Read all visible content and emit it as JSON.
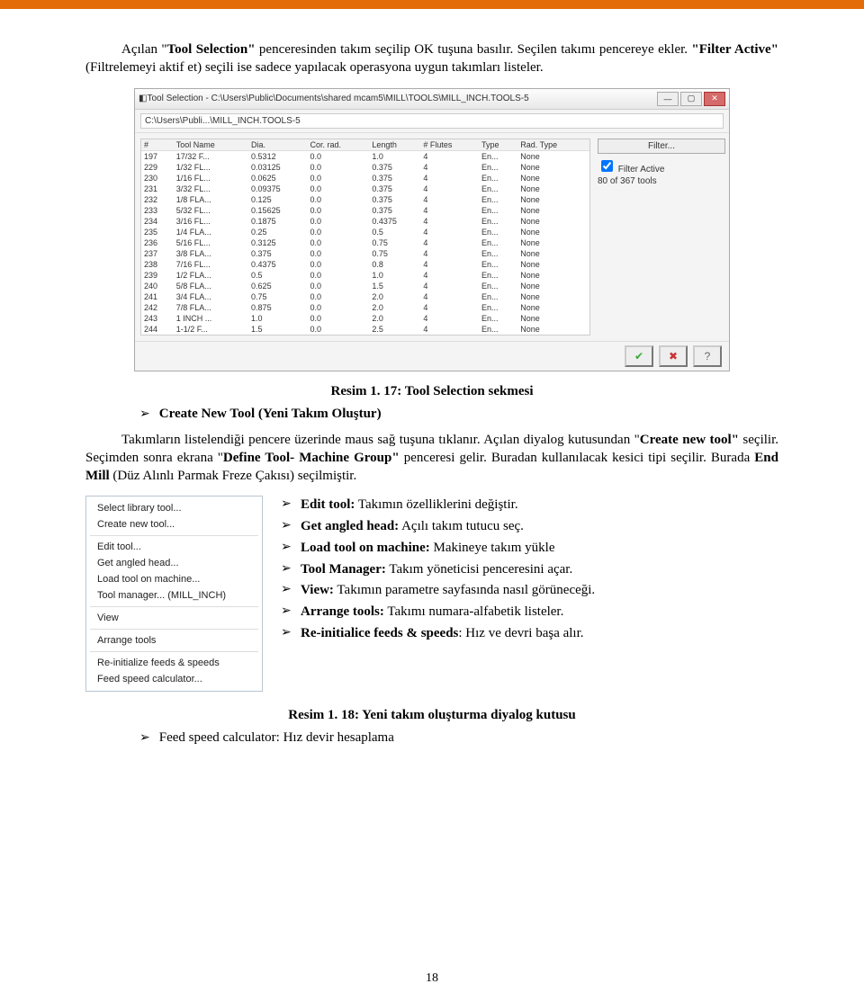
{
  "intro": {
    "sentence1_prefix": "Açılan \"",
    "sentence1_bold": "Tool Selection\"",
    "sentence1_suffix": " penceresinden takım seçilip OK tuşuna basılır. Seçilen takımı pencereye ekler. ",
    "sentence2_bold": "\"Filter Active\"",
    "sentence2_suffix": " (Filtrelemeyi aktif et) seçili ise sadece yapılacak operasyona uygun takımları listeler."
  },
  "win": {
    "title": "Tool Selection - C:\\Users\\Public\\Documents\\shared mcam5\\MILL\\TOOLS\\MILL_INCH.TOOLS-5",
    "path": "C:\\Users\\Publi...\\MILL_INCH.TOOLS-5",
    "winbtn_min": "—",
    "winbtn_max": "▢",
    "winbtn_close": "✕",
    "headers": [
      "#",
      "Tool Name",
      "Dia.",
      "Cor. rad.",
      "Length",
      "# Flutes",
      "Type",
      "Rad. Type"
    ],
    "rows": [
      [
        "197",
        "17/32 F...",
        "0.5312",
        "0.0",
        "1.0",
        "4",
        "En...",
        "None"
      ],
      [
        "229",
        "1/32 FL...",
        "0.03125",
        "0.0",
        "0.375",
        "4",
        "En...",
        "None"
      ],
      [
        "230",
        "1/16 FL...",
        "0.0625",
        "0.0",
        "0.375",
        "4",
        "En...",
        "None"
      ],
      [
        "231",
        "3/32 FL...",
        "0.09375",
        "0.0",
        "0.375",
        "4",
        "En...",
        "None"
      ],
      [
        "232",
        "1/8 FLA...",
        "0.125",
        "0.0",
        "0.375",
        "4",
        "En...",
        "None"
      ],
      [
        "233",
        "5/32 FL...",
        "0.15625",
        "0.0",
        "0.375",
        "4",
        "En...",
        "None"
      ],
      [
        "234",
        "3/16 FL...",
        "0.1875",
        "0.0",
        "0.4375",
        "4",
        "En...",
        "None"
      ],
      [
        "235",
        "1/4 FLA...",
        "0.25",
        "0.0",
        "0.5",
        "4",
        "En...",
        "None"
      ],
      [
        "236",
        "5/16 FL...",
        "0.3125",
        "0.0",
        "0.75",
        "4",
        "En...",
        "None"
      ],
      [
        "237",
        "3/8 FLA...",
        "0.375",
        "0.0",
        "0.75",
        "4",
        "En...",
        "None"
      ],
      [
        "238",
        "7/16 FL...",
        "0.4375",
        "0.0",
        "0.8",
        "4",
        "En...",
        "None"
      ],
      [
        "239",
        "1/2 FLA...",
        "0.5",
        "0.0",
        "1.0",
        "4",
        "En...",
        "None"
      ],
      [
        "240",
        "5/8 FLA...",
        "0.625",
        "0.0",
        "1.5",
        "4",
        "En...",
        "None"
      ],
      [
        "241",
        "3/4 FLA...",
        "0.75",
        "0.0",
        "2.0",
        "4",
        "En...",
        "None"
      ],
      [
        "242",
        "7/8 FLA...",
        "0.875",
        "0.0",
        "2.0",
        "4",
        "En...",
        "None"
      ],
      [
        "243",
        "1 INCH ...",
        "1.0",
        "0.0",
        "2.0",
        "4",
        "En...",
        "None"
      ],
      [
        "244",
        "1-1/2 F...",
        "1.5",
        "0.0",
        "2.5",
        "4",
        "En...",
        "None"
      ]
    ],
    "filter_label": "Filter...",
    "chk_label": "Filter Active",
    "count": "80 of 367 tools",
    "ok": "✔",
    "cancel": "✖",
    "help": "?"
  },
  "caption1": "Resim 1. 17: Tool Selection sekmesi",
  "create_line": "Create New Tool (Yeni Takım Oluştur)",
  "para2": {
    "t1": "Takımların listelendiği pencere üzerinde maus sağ tuşuna tıklanır. Açılan diyalog kutusundan \"",
    "b1": "Create new tool\"",
    "t2": " seçilir. Seçimden sonra ekrana \"",
    "b2": "Define Tool- Machine Group\"",
    "t3": " penceresi gelir. Buradan kullanılacak kesici tipi seçilir. Burada ",
    "b3": "End Mill",
    "t4": " (Düz Alınlı Parmak Freze Çakısı) seçilmiştir."
  },
  "menu": [
    "Select library tool...",
    "Create new tool...",
    "Edit tool...",
    "Get angled head...",
    "Load tool on machine...",
    "Tool manager...  (MILL_INCH)",
    "View",
    "Arrange tools",
    "Re-initialize feeds & speeds",
    "Feed speed calculator..."
  ],
  "bullets": [
    {
      "bold": "Edit tool:",
      "rest": " Takımın özelliklerini değiştir."
    },
    {
      "bold": "Get angled head:",
      "rest": " Açılı takım tutucu seç."
    },
    {
      "bold": "Load tool on machine:",
      "rest": " Makineye takım yükle"
    },
    {
      "bold": "Tool Manager:",
      "rest": " Takım yöneticisi penceresini açar."
    },
    {
      "bold": "View:",
      "rest": " Takımın parametre sayfasında nasıl görüneceği."
    },
    {
      "bold": "Arrange tools:",
      "rest": " Takımı numara-alfabetik listeler."
    },
    {
      "bold": "Re-initialice feeds & speeds",
      "rest": ": Hız ve devri başa alır."
    }
  ],
  "caption2": "Resim 1. 18: Yeni takım oluşturma diyalog kutusu",
  "feed_line": "Feed speed calculator: Hız devir hesaplama",
  "pagenum": "18",
  "chevron": "➢"
}
